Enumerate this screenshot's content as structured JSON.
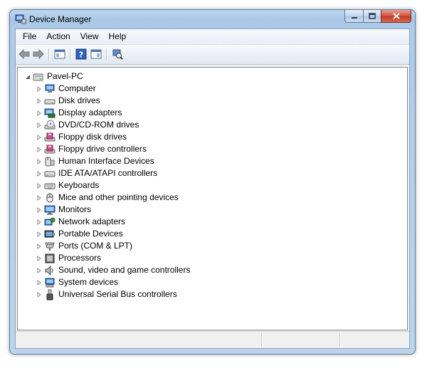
{
  "window": {
    "title": "Device Manager"
  },
  "menubar": {
    "items": [
      "File",
      "Action",
      "View",
      "Help"
    ]
  },
  "toolbar": {
    "buttons": [
      "back-icon",
      "forward-icon",
      "show-hide-console-tree-icon",
      "help-icon",
      "properties-pane-icon",
      "scan-hardware-icon"
    ]
  },
  "tree": {
    "root": "Pavel-PC",
    "items": [
      {
        "label": "Computer",
        "icon": "computer-icon"
      },
      {
        "label": "Disk drives",
        "icon": "disk-drive-icon"
      },
      {
        "label": "Display adapters",
        "icon": "display-adapter-icon"
      },
      {
        "label": "DVD/CD-ROM drives",
        "icon": "dvd-drive-icon"
      },
      {
        "label": "Floppy disk drives",
        "icon": "floppy-disk-icon"
      },
      {
        "label": "Floppy drive controllers",
        "icon": "floppy-controller-icon"
      },
      {
        "label": "Human Interface Devices",
        "icon": "hid-icon"
      },
      {
        "label": "IDE ATA/ATAPI controllers",
        "icon": "ide-controller-icon"
      },
      {
        "label": "Keyboards",
        "icon": "keyboard-icon"
      },
      {
        "label": "Mice and other pointing devices",
        "icon": "mouse-icon"
      },
      {
        "label": "Monitors",
        "icon": "monitor-icon"
      },
      {
        "label": "Network adapters",
        "icon": "network-adapter-icon"
      },
      {
        "label": "Portable Devices",
        "icon": "portable-device-icon"
      },
      {
        "label": "Ports (COM & LPT)",
        "icon": "port-icon"
      },
      {
        "label": "Processors",
        "icon": "processor-icon"
      },
      {
        "label": "Sound, video and game controllers",
        "icon": "speaker-icon"
      },
      {
        "label": "System devices",
        "icon": "system-device-icon"
      },
      {
        "label": "Universal Serial Bus controllers",
        "icon": "usb-icon"
      }
    ]
  },
  "colors": {
    "window_frame": "#a9c8e6",
    "close_button": "#c03a26",
    "tree_background": "#ffffff"
  }
}
